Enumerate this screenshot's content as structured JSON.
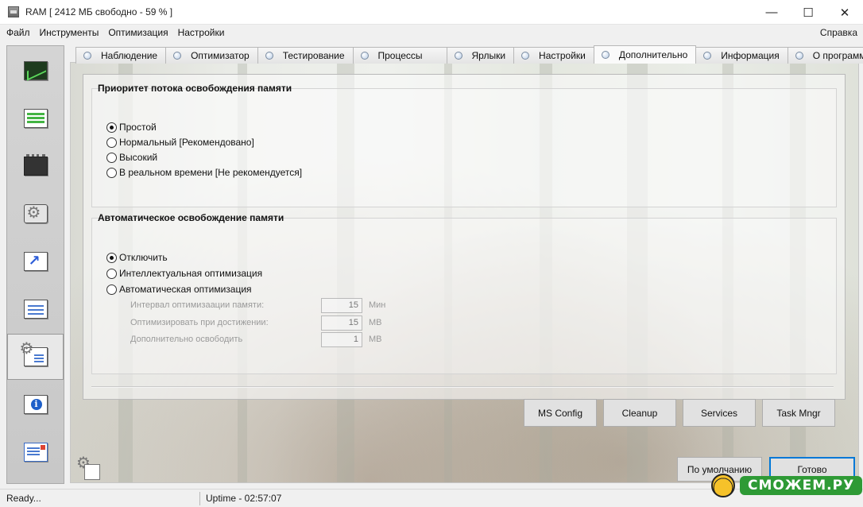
{
  "window": {
    "title": "RAM [ 2412 МБ свободно - 59 % ]",
    "controls": [
      "—",
      "☐",
      "✕"
    ]
  },
  "menu": {
    "items": [
      "Файл",
      "Инструменты",
      "Оптимизация",
      "Настройки"
    ],
    "help": "Справка"
  },
  "sidebar": {
    "icons": [
      "monitor-graph-icon",
      "bars-icon",
      "ram-chip-icon",
      "gears-icon",
      "shortcut-arrow-icon",
      "checklist-icon",
      "settings-checklist-icon",
      "info-icon",
      "mail-icon"
    ],
    "active_index": 6
  },
  "tabs": [
    {
      "label": "Наблюдение"
    },
    {
      "label": "Оптимизатор"
    },
    {
      "label": "Тестирование"
    },
    {
      "label": "Процессы"
    },
    {
      "label": "Ярлыки"
    },
    {
      "label": "Настройки"
    },
    {
      "label": "Дополнительно",
      "active": true
    },
    {
      "label": "Информация"
    },
    {
      "label": "О программе"
    }
  ],
  "priority_group": {
    "title": "Приоритет потока освобождения памяти",
    "options": [
      "Простой",
      "Нормальный [Рекомендовано]",
      "Высокий",
      "В реальном времени [Не рекомендуется]"
    ],
    "selected": 0
  },
  "auto_group": {
    "title": "Автоматическое освобождение памяти",
    "options": [
      "Отключить",
      "Интеллектуальная оптимизация",
      "Автоматическая оптимизация"
    ],
    "selected": 0,
    "fields": [
      {
        "label": "Интервал оптимизаации памяти:",
        "value": "15",
        "unit": "Мин"
      },
      {
        "label": "Оптимизировать при достижении:",
        "value": "15",
        "unit": "МВ"
      },
      {
        "label": "Дополнительно освободить",
        "value": "1",
        "unit": "МВ"
      }
    ]
  },
  "tools": [
    "MS Config",
    "Cleanup",
    "Services",
    "Task Mngr"
  ],
  "footer_buttons": {
    "defaults": "По умолчанию",
    "done": "Готово"
  },
  "status": {
    "left": "Ready...",
    "uptime": "Uptime - 02:57:07"
  },
  "watermark": "СМОЖЕМ.РУ",
  "colors": {
    "accent": "#0078d7",
    "titlebar": "#ffffff",
    "window_bg": "#f0f0f0"
  }
}
